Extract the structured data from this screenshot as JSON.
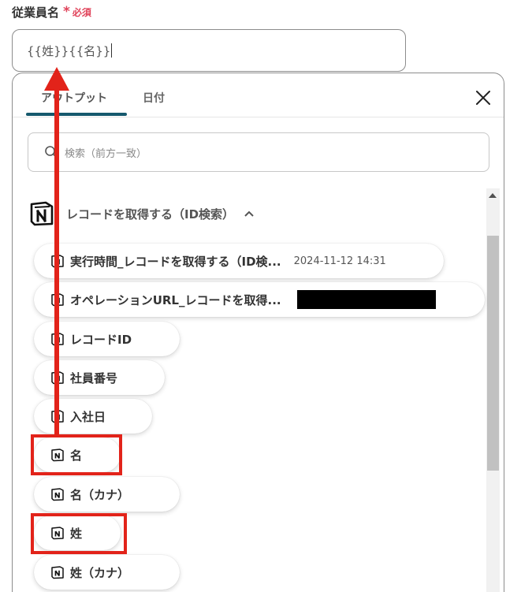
{
  "field": {
    "label": "従業員名",
    "asterisk": "*",
    "required": "必須",
    "value": "{{姓}}{{名}}"
  },
  "tabs": {
    "output": "アウトプット",
    "date": "日付"
  },
  "search": {
    "placeholder": "検索（前方一致）"
  },
  "section": {
    "title": "レコードを取得する（ID検索）"
  },
  "items": [
    {
      "label": "実行時間_レコードを取得する（ID検...",
      "value": "2024-11-12 14:31"
    },
    {
      "label": "オペレーションURL_レコードを取得...",
      "value": ""
    },
    {
      "label": "レコードID"
    },
    {
      "label": "社員番号"
    },
    {
      "label": "入社日"
    },
    {
      "label": "名"
    },
    {
      "label": "名（カナ）"
    },
    {
      "label": "姓"
    },
    {
      "label": "姓（カナ）"
    }
  ],
  "icons": {
    "notion": "notion-icon",
    "search": "search-icon",
    "close": "close-icon",
    "collapse": "chevron-up-icon"
  },
  "colors": {
    "tab_accent": "#16596d",
    "required": "#e0435a",
    "annotation": "#e2231a"
  }
}
